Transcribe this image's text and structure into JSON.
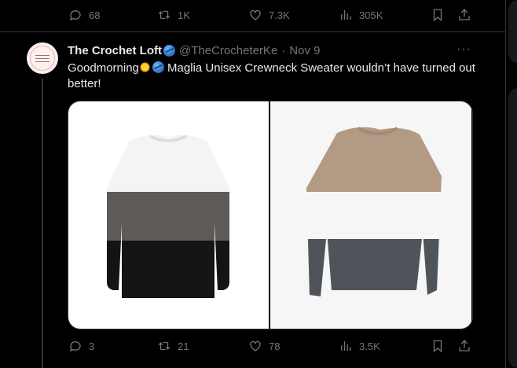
{
  "prev_tweet_actions": {
    "replies": "68",
    "reposts": "1K",
    "likes": "7.3K",
    "views": "305K"
  },
  "tweet": {
    "author_name": "The Crochet Loft",
    "name_emoji": "yarn-ball-icon",
    "handle": "@TheCrocheterKe",
    "separator": "·",
    "date": "Nov 9",
    "more": "···",
    "text_before": "Goodmorning",
    "text_after": " Maglia Unisex Crewneck Sweater wouldn’t have turned out better!",
    "avatar_text": "CROCHET LOFT",
    "media": [
      {
        "label": "sweater-white-grey-black",
        "colors": [
          "#f4f4f6",
          "#5e5b57",
          "#141414"
        ]
      },
      {
        "label": "sweater-tan-white-grey",
        "colors": [
          "#b39a84",
          "#f7f7f7",
          "#4e5459"
        ]
      }
    ],
    "actions": {
      "replies": "3",
      "reposts": "21",
      "likes": "78",
      "views": "3.5K"
    }
  },
  "colors": {
    "background": "#000000",
    "text": "#e7e9ea",
    "muted": "#71767b",
    "border": "#2f3336"
  }
}
